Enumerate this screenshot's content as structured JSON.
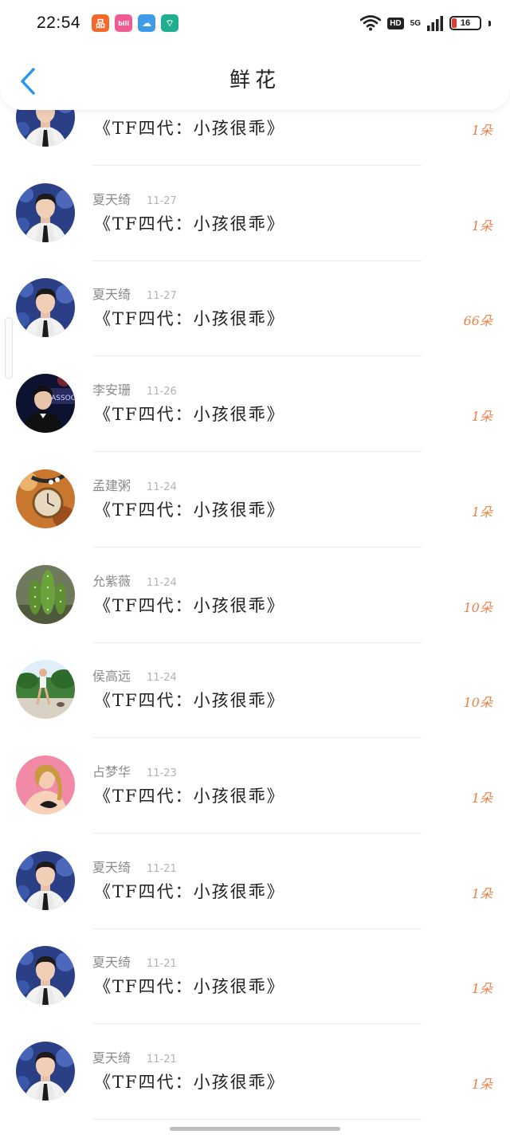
{
  "status_bar": {
    "time": "22:54",
    "network": "5G",
    "hd": "HD",
    "battery": "16",
    "notification_icons": [
      {
        "name": "shopping-app-icon",
        "color": "#f5682c",
        "glyph": "品"
      },
      {
        "name": "bilibili-app-icon",
        "color": "#ef5c92",
        "glyph": "bili"
      },
      {
        "name": "weather-app-icon",
        "color": "#3d9be9",
        "glyph": "☁"
      },
      {
        "name": "hotspot-app-icon",
        "color": "#1fae8f",
        "glyph": "⌔"
      }
    ]
  },
  "header": {
    "title": "鲜花",
    "back_icon": "chevron-left-icon",
    "accent": "#2196f3"
  },
  "items": [
    {
      "sender": "",
      "date": "",
      "message": "《TF四代：小孩很乖》",
      "gift": "1朵",
      "avatar": "portrait-suit"
    },
    {
      "sender": "夏天绮",
      "date": "11-27",
      "message": "《TF四代：小孩很乖》",
      "gift": "1朵",
      "avatar": "portrait-suit"
    },
    {
      "sender": "夏天绮",
      "date": "11-27",
      "message": "《TF四代：小孩很乖》",
      "gift": "66朵",
      "avatar": "portrait-suit"
    },
    {
      "sender": "李安珊",
      "date": "11-26",
      "message": "《TF四代：小孩很乖》",
      "gift": "1朵",
      "avatar": "portrait-dark"
    },
    {
      "sender": "孟建粥",
      "date": "11-24",
      "message": "《TF四代：小孩很乖》",
      "gift": "1朵",
      "avatar": "pocket-watch"
    },
    {
      "sender": "允紫薇",
      "date": "11-24",
      "message": "《TF四代：小孩很乖》",
      "gift": "10朵",
      "avatar": "cactus"
    },
    {
      "sender": "侯高远",
      "date": "11-24",
      "message": "《TF四代：小孩很乖》",
      "gift": "10朵",
      "avatar": "runner"
    },
    {
      "sender": "占梦华",
      "date": "11-23",
      "message": "《TF四代：小孩很乖》",
      "gift": "1朵",
      "avatar": "woman-pink"
    },
    {
      "sender": "夏天绮",
      "date": "11-21",
      "message": "《TF四代：小孩很乖》",
      "gift": "1朵",
      "avatar": "portrait-suit"
    },
    {
      "sender": "夏天绮",
      "date": "11-21",
      "message": "《TF四代：小孩很乖》",
      "gift": "1朵",
      "avatar": "portrait-suit"
    },
    {
      "sender": "夏天绮",
      "date": "11-21",
      "message": "《TF四代：小孩很乖》",
      "gift": "1朵",
      "avatar": "portrait-suit"
    }
  ],
  "colors": {
    "gift": "#e8824a",
    "sender": "#8a8a8a",
    "date": "#b3b3b3",
    "message": "#222222"
  }
}
